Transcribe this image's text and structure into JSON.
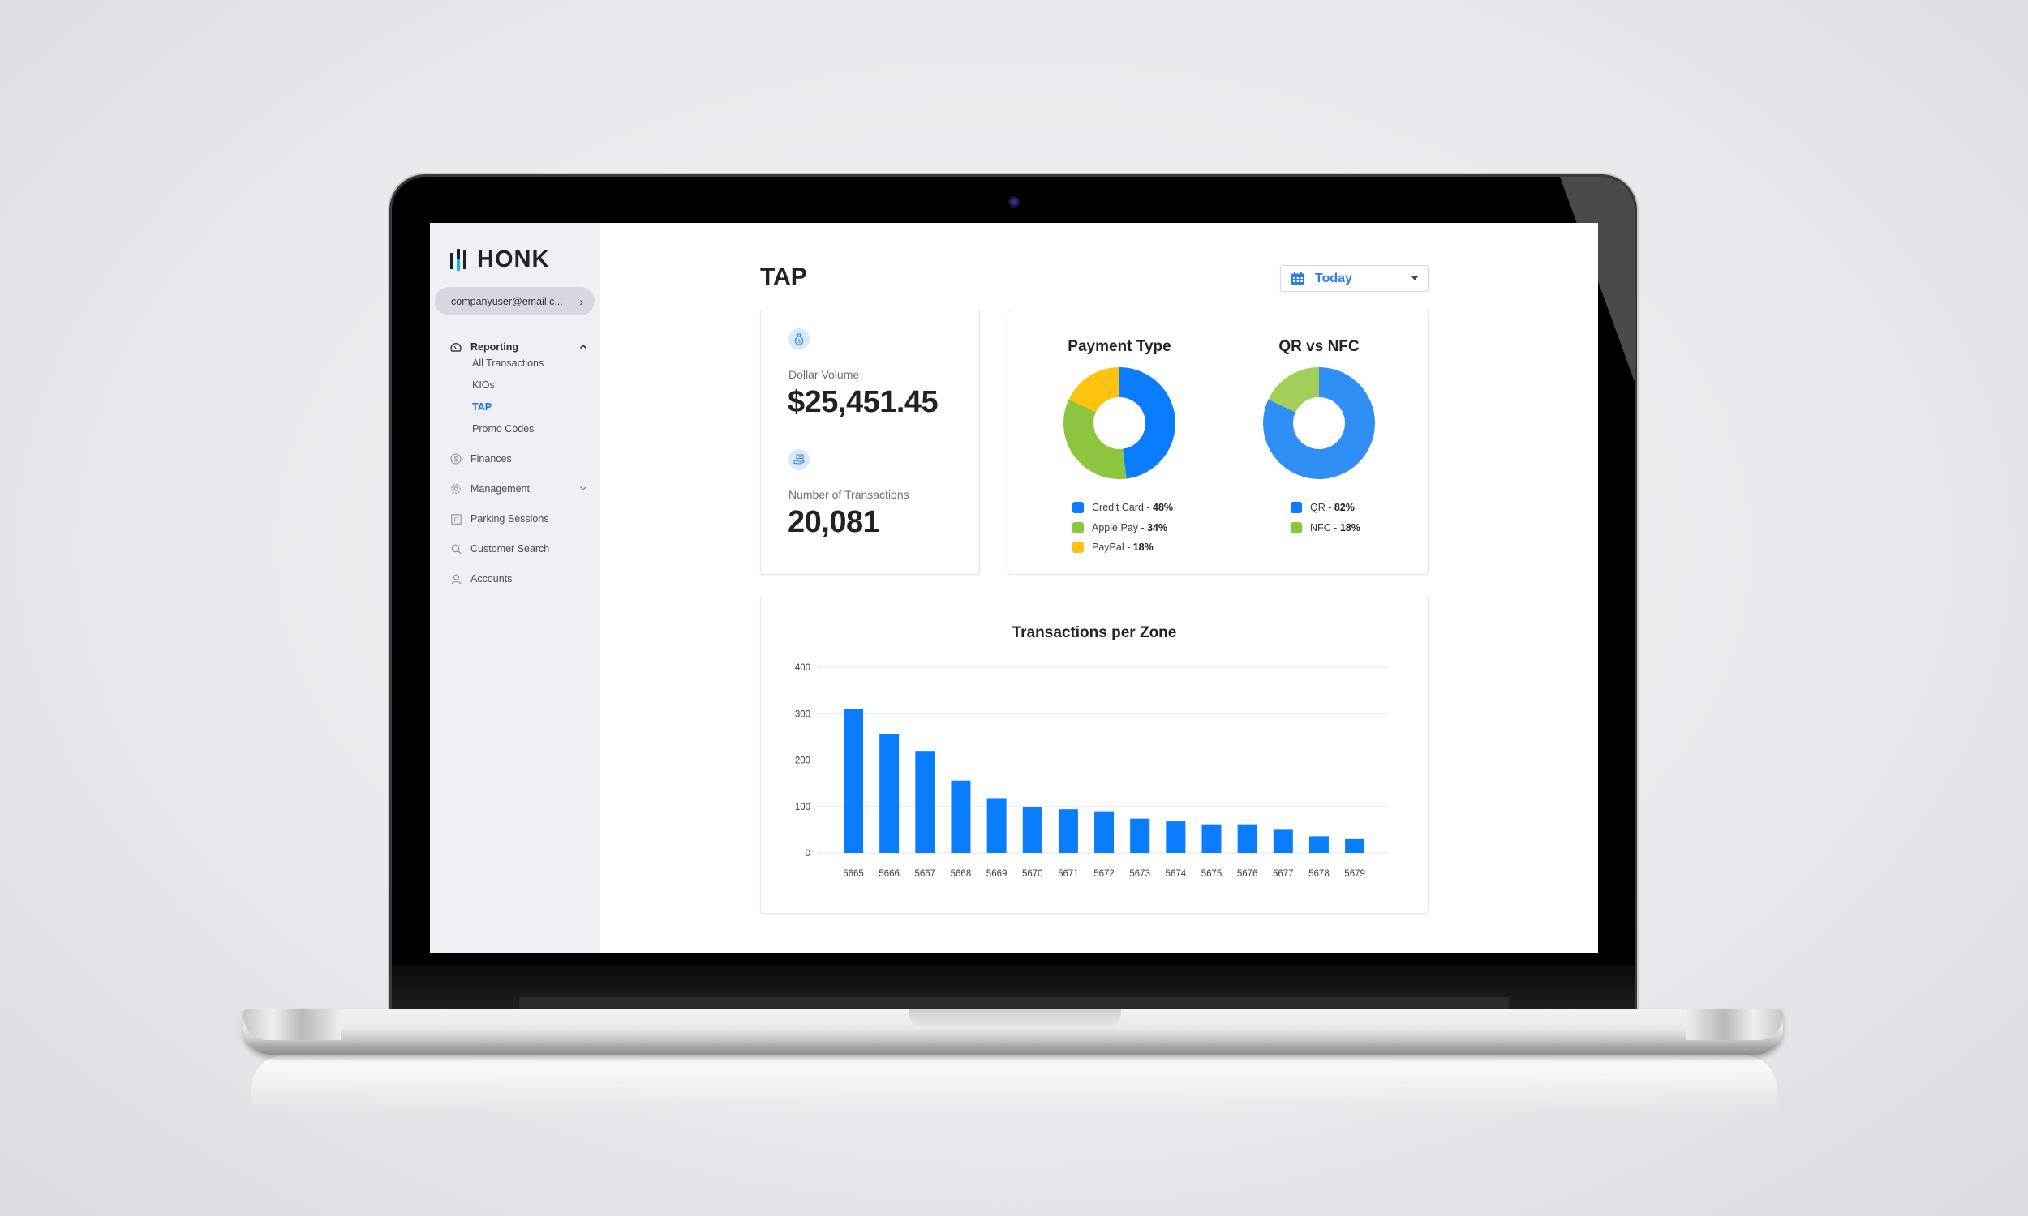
{
  "app": {
    "brand": "HONK",
    "user_email": "companyuser@email.c...",
    "user_chevron": "›"
  },
  "sidebar": {
    "sections": [
      {
        "label": "Reporting",
        "icon": "dashboard-gauge-icon",
        "expanded": true,
        "arrow": "⌃"
      },
      {
        "label": "Finances",
        "icon": "dollar-circle-icon"
      },
      {
        "label": "Management",
        "icon": "gear-icon",
        "arrow": "⌄"
      },
      {
        "label": "Parking Sessions",
        "icon": "parking-icon"
      },
      {
        "label": "Customer Search",
        "icon": "search-icon"
      },
      {
        "label": "Accounts",
        "icon": "user-icon"
      }
    ],
    "reporting_items": [
      {
        "label": "All Transactions",
        "active": false
      },
      {
        "label": "KIOs",
        "active": false
      },
      {
        "label": "TAP",
        "active": true
      },
      {
        "label": "Promo Codes",
        "active": false
      }
    ]
  },
  "header": {
    "title": "TAP",
    "date_filter": {
      "value": "Today",
      "icon": "calendar-icon"
    }
  },
  "stats": {
    "dollar_volume": {
      "label": "Dollar Volume",
      "value": "$25,451.45",
      "icon": "money-bag-icon"
    },
    "transactions": {
      "label": "Number of Transactions",
      "value": "20,081",
      "icon": "money-hand-icon"
    }
  },
  "colors": {
    "accent": "#1a73e8",
    "blue": "#0a7cff",
    "light_blue": "#2f8ff5",
    "green": "#8cc63f",
    "light_green": "#a1cf5a",
    "yellow": "#ffc20e"
  },
  "chart_data": [
    {
      "type": "pie",
      "title": "Payment Type",
      "donut": true,
      "slices": [
        {
          "label": "Credit Card",
          "value": 48,
          "display": "48%",
          "color": "#0a7cff"
        },
        {
          "label": "Apple Pay",
          "value": 34,
          "display": "34%",
          "color": "#8cc63f"
        },
        {
          "label": "PayPal",
          "value": 18,
          "display": "18%",
          "color": "#ffc20e"
        }
      ],
      "legend": "bottom"
    },
    {
      "type": "pie",
      "title": "QR vs NFC",
      "donut": true,
      "slices": [
        {
          "label": "QR",
          "value": 82,
          "display": "82%",
          "color": "#2f8ff5"
        },
        {
          "label": "NFC",
          "value": 18,
          "display": "18%",
          "color": "#a1cf5a"
        }
      ],
      "legend_colors": [
        "#0a7cff",
        "#8cc63f"
      ],
      "legend": "bottom"
    },
    {
      "type": "bar",
      "title": "Transactions per Zone",
      "xlabel": "",
      "ylabel": "",
      "categories": [
        "5665",
        "5666",
        "5667",
        "5668",
        "5669",
        "5670",
        "5671",
        "5672",
        "5673",
        "5674",
        "5675",
        "5676",
        "5677",
        "5678",
        "5679"
      ],
      "values": [
        310,
        255,
        218,
        156,
        118,
        98,
        94,
        88,
        74,
        68,
        60,
        60,
        50,
        36,
        30
      ],
      "ylim": [
        0,
        400
      ],
      "yticks": [
        0,
        100,
        200,
        300,
        400
      ],
      "grid": true,
      "color": "#0a7cff"
    }
  ]
}
